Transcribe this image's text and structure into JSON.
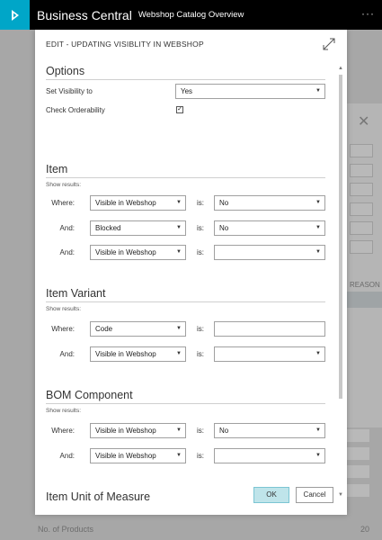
{
  "app": {
    "title": "Business Central",
    "page_name": "Webshop Catalog Overview",
    "more_label": "···"
  },
  "background": {
    "column_header": "REASON",
    "footer_label": "No. of Products",
    "footer_value": "20"
  },
  "dialog": {
    "title": "EDIT - UPDATING VISIBLITY IN WEBSHOP",
    "options": {
      "title": "Options",
      "visibility_label": "Set Visibility to",
      "visibility_value": "Yes",
      "orderability_label": "Check Orderability",
      "orderability_checked": true
    },
    "show_results_label": "Show results:",
    "is_label": "is:",
    "sections": [
      {
        "title": "Item",
        "rows": [
          {
            "label": "Where:",
            "field": "Visible in Webshop",
            "value": "No",
            "value_is_select": true
          },
          {
            "label": "And:",
            "field": "Blocked",
            "value": "No",
            "value_is_select": true
          },
          {
            "label": "And:",
            "field": "Visible in Webshop",
            "value": "",
            "value_is_select": true
          }
        ]
      },
      {
        "title": "Item Variant",
        "rows": [
          {
            "label": "Where:",
            "field": "Code",
            "value": "",
            "value_is_select": false
          },
          {
            "label": "And:",
            "field": "Visible in Webshop",
            "value": "",
            "value_is_select": true
          }
        ]
      },
      {
        "title": "BOM Component",
        "rows": [
          {
            "label": "Where:",
            "field": "Visible in Webshop",
            "value": "No",
            "value_is_select": true
          },
          {
            "label": "And:",
            "field": "Visible in Webshop",
            "value": "",
            "value_is_select": true
          }
        ]
      },
      {
        "title": "Item Unit of Measure",
        "rows": []
      }
    ],
    "ok_label": "OK",
    "cancel_label": "Cancel"
  },
  "colors": {
    "brand": "#00a6c8",
    "topbar": "#000000",
    "ok_button": "#bfe4ea",
    "overlay": "#a7a7a7"
  }
}
